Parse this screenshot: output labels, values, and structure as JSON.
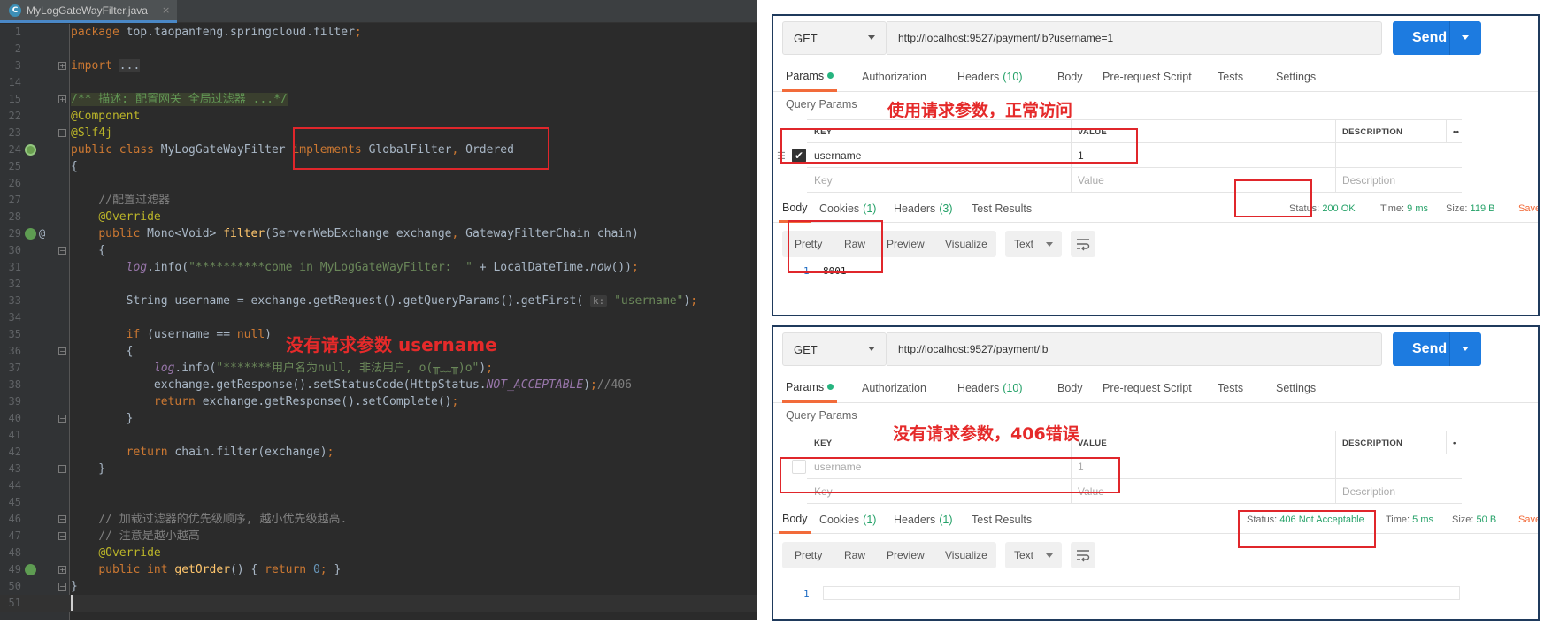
{
  "ide": {
    "tab_label": "MyLogGateWayFilter.java",
    "class_icon_letter": "C",
    "close_glyph": "×",
    "line_numbers": [
      "1",
      "2",
      "3",
      "14",
      "15",
      "22",
      "23",
      "24",
      "25",
      "26",
      "27",
      "28",
      "29",
      "30",
      "31",
      "32",
      "33",
      "34",
      "35",
      "36",
      "37",
      "38",
      "39",
      "40",
      "41",
      "42",
      "43",
      "44",
      "45",
      "46",
      "47",
      "48",
      "49",
      "50",
      "51"
    ],
    "fold_placeholder": "...",
    "doc_comment": "/** 描述: 配置网关 全局过滤器 ...*/",
    "comment_config": "//配置过滤器",
    "log_come_in": "\"**********come in MyLogGateWayFilter:  \"",
    "hint_k": "k:",
    "str_username": "\"username\"",
    "log_invalid": "\"*******用户名为null, 非法用户, o(╥﹏╥)o\"",
    "comment_406": "//406",
    "comment_order1": "// 加载过滤器的优先级顺序, 越小优先级越高.",
    "comment_order2": "// 注意是越小越高",
    "zero": "0"
  },
  "annotations": {
    "ide_missing_param": "没有请求参数 username",
    "top_ok": "使用请求参数，正常访问",
    "bottom_err": "没有请求参数，406错误"
  },
  "postman_top": {
    "method": "GET",
    "url": "http://localhost:9527/payment/lb?username=1",
    "send": "Send",
    "tabs": [
      "Params",
      "Authorization",
      "Headers",
      "Body",
      "Pre-request Script",
      "Tests",
      "Settings"
    ],
    "headers_count": "(10)",
    "query_params_title": "Query Params",
    "col_key": "KEY",
    "col_value": "VALUE",
    "col_description": "DESCRIPTION",
    "col_more": "••",
    "row_key": "username",
    "row_value": "1",
    "ph_key": "Key",
    "ph_value": "Value",
    "ph_description": "Description",
    "resp_tabs": [
      "Body",
      "Cookies",
      "Headers",
      "Test Results"
    ],
    "cookies_count": "(1)",
    "resp_headers_count": "(3)",
    "status_label": "Status:",
    "status_value": "200 OK",
    "time_label": "Time:",
    "time_value": "9 ms",
    "size_label": "Size:",
    "size_value": "119 B",
    "save": "Save",
    "formats": [
      "Pretty",
      "Raw",
      "Preview",
      "Visualize"
    ],
    "text_format": "Text",
    "body_line_num": "1",
    "body_line": "8001"
  },
  "postman_bottom": {
    "method": "GET",
    "url": "http://localhost:9527/payment/lb",
    "send": "Send",
    "tabs": [
      "Params",
      "Authorization",
      "Headers",
      "Body",
      "Pre-request Script",
      "Tests",
      "Settings"
    ],
    "headers_count": "(10)",
    "query_params_title": "Query Params",
    "col_key": "KEY",
    "col_value": "VALUE",
    "col_description": "DESCRIPTION",
    "col_more": "•",
    "row_key": "username",
    "row_value": "1",
    "ph_key": "Key",
    "ph_value": "Value",
    "ph_description": "Description",
    "resp_tabs": [
      "Body",
      "Cookies",
      "Headers",
      "Test Results"
    ],
    "cookies_count": "(1)",
    "resp_headers_count": "(1)",
    "status_label": "Status:",
    "status_value": "406 Not Acceptable",
    "time_label": "Time:",
    "time_value": "5 ms",
    "size_label": "Size:",
    "size_value": "50 B",
    "save": "Save",
    "formats": [
      "Pretty",
      "Raw",
      "Preview",
      "Visualize"
    ],
    "text_format": "Text",
    "body_line_num": "1"
  },
  "colors": {
    "annotation_red": "#e52a2a",
    "send_blue": "#1d7be0",
    "status_green": "#26a269",
    "tab_accent": "#f26b3a"
  }
}
